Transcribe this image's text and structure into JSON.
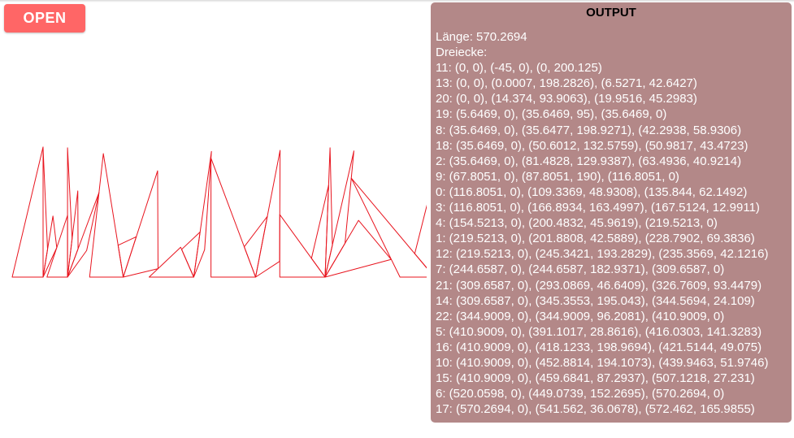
{
  "open_button": {
    "label": "OPEN"
  },
  "output": {
    "title": "OUTPUT",
    "length_line": "Länge: 570.2694",
    "triangles_heading": "Dreiecke:",
    "lines": [
      "11: (0, 0), (-45, 0), (0, 200.125)",
      "13: (0, 0), (0.0007, 198.2826), (6.5271, 42.6427)",
      "20: (0, 0), (14.374, 93.9063), (19.9516, 45.2983)",
      "19: (5.6469, 0), (35.6469, 95), (35.6469, 0)",
      "8: (35.6469, 0), (35.6477, 198.9271), (42.2938, 58.9306)",
      "18: (35.6469, 0), (50.6012, 132.5759), (50.9817, 43.4723)",
      "2: (35.6469, 0), (81.4828, 129.9387), (63.4936, 40.9214)",
      "9: (67.8051, 0), (87.8051, 190), (116.8051, 0)",
      "0: (116.8051, 0), (109.3369, 48.9308), (135.844, 62.1492)",
      "3: (116.8051, 0), (166.8934, 163.4997), (167.5124, 12.9911)",
      "4: (154.5213, 0), (200.4832, 45.9619), (219.5213, 0)",
      "1: (219.5213, 0), (201.8808, 42.5889), (228.7902, 69.3836)",
      "12: (219.5213, 0), (245.3421, 193.2829), (235.3569, 42.1216)",
      "7: (244.6587, 0), (244.6587, 182.9371), (309.6587, 0)",
      "21: (309.6587, 0), (293.0869, 46.6409), (326.7609, 93.4479)",
      "14: (309.6587, 0), (345.3553, 195.043), (344.5694, 24.109)",
      "22: (344.9009, 0), (344.9009, 96.2081), (410.9009, 0)",
      "5: (410.9009, 0), (391.1017, 28.8616), (416.0303, 141.3283)",
      "16: (410.9009, 0), (418.1233, 198.9694), (421.5144, 49.075)",
      "10: (410.9009, 0), (452.8814, 194.1073), (439.9463, 51.9746)",
      "15: (410.9009, 0), (459.6841, 87.2937), (507.1218, 27.231)",
      "6: (520.0598, 0), (449.0739, 152.2695), (570.2694, 0)",
      "17: (570.2694, 0), (541.562, 36.0678), (572.462, 165.9855)"
    ]
  },
  "drawing": {
    "stroke_color": "#e8141e",
    "triangles": [
      {
        "id": "11",
        "points": [
          [
            0,
            0
          ],
          [
            -45,
            0
          ],
          [
            0,
            200.125
          ]
        ]
      },
      {
        "id": "13",
        "points": [
          [
            0,
            0
          ],
          [
            0.0007,
            198.2826
          ],
          [
            6.5271,
            42.6427
          ]
        ]
      },
      {
        "id": "20",
        "points": [
          [
            0,
            0
          ],
          [
            14.374,
            93.9063
          ],
          [
            19.9516,
            45.2983
          ]
        ]
      },
      {
        "id": "19",
        "points": [
          [
            5.6469,
            0
          ],
          [
            35.6469,
            95
          ],
          [
            35.6469,
            0
          ]
        ]
      },
      {
        "id": "8",
        "points": [
          [
            35.6469,
            0
          ],
          [
            35.6477,
            198.9271
          ],
          [
            42.2938,
            58.9306
          ]
        ]
      },
      {
        "id": "18",
        "points": [
          [
            35.6469,
            0
          ],
          [
            50.6012,
            132.5759
          ],
          [
            50.9817,
            43.4723
          ]
        ]
      },
      {
        "id": "2",
        "points": [
          [
            35.6469,
            0
          ],
          [
            81.4828,
            129.9387
          ],
          [
            63.4936,
            40.9214
          ]
        ]
      },
      {
        "id": "9",
        "points": [
          [
            67.8051,
            0
          ],
          [
            87.8051,
            190
          ],
          [
            116.8051,
            0
          ]
        ]
      },
      {
        "id": "0",
        "points": [
          [
            116.8051,
            0
          ],
          [
            109.3369,
            48.9308
          ],
          [
            135.844,
            62.1492
          ]
        ]
      },
      {
        "id": "3",
        "points": [
          [
            116.8051,
            0
          ],
          [
            166.8934,
            163.4997
          ],
          [
            167.5124,
            12.9911
          ]
        ]
      },
      {
        "id": "4",
        "points": [
          [
            154.5213,
            0
          ],
          [
            200.4832,
            45.9619
          ],
          [
            219.5213,
            0
          ]
        ]
      },
      {
        "id": "1",
        "points": [
          [
            219.5213,
            0
          ],
          [
            201.8808,
            42.5889
          ],
          [
            228.7902,
            69.3836
          ]
        ]
      },
      {
        "id": "12",
        "points": [
          [
            219.5213,
            0
          ],
          [
            245.3421,
            193.2829
          ],
          [
            235.3569,
            42.1216
          ]
        ]
      },
      {
        "id": "7",
        "points": [
          [
            244.6587,
            0
          ],
          [
            244.6587,
            182.9371
          ],
          [
            309.6587,
            0
          ]
        ]
      },
      {
        "id": "21",
        "points": [
          [
            309.6587,
            0
          ],
          [
            293.0869,
            46.6409
          ],
          [
            326.7609,
            93.4479
          ]
        ]
      },
      {
        "id": "14",
        "points": [
          [
            309.6587,
            0
          ],
          [
            345.3553,
            195.043
          ],
          [
            344.5694,
            24.109
          ]
        ]
      },
      {
        "id": "22",
        "points": [
          [
            344.9009,
            0
          ],
          [
            344.9009,
            96.2081
          ],
          [
            410.9009,
            0
          ]
        ]
      },
      {
        "id": "5",
        "points": [
          [
            410.9009,
            0
          ],
          [
            391.1017,
            28.8616
          ],
          [
            416.0303,
            141.3283
          ]
        ]
      },
      {
        "id": "16",
        "points": [
          [
            410.9009,
            0
          ],
          [
            418.1233,
            198.9694
          ],
          [
            421.5144,
            49.075
          ]
        ]
      },
      {
        "id": "10",
        "points": [
          [
            410.9009,
            0
          ],
          [
            452.8814,
            194.1073
          ],
          [
            439.9463,
            51.9746
          ]
        ]
      },
      {
        "id": "15",
        "points": [
          [
            410.9009,
            0
          ],
          [
            459.6841,
            87.2937
          ],
          [
            507.1218,
            27.231
          ]
        ]
      },
      {
        "id": "6",
        "points": [
          [
            520.0598,
            0
          ],
          [
            449.0739,
            152.2695
          ],
          [
            570.2694,
            0
          ]
        ]
      },
      {
        "id": "17",
        "points": [
          [
            570.2694,
            0
          ],
          [
            541.562,
            36.0678
          ],
          [
            572.462,
            165.9855
          ]
        ]
      }
    ]
  }
}
